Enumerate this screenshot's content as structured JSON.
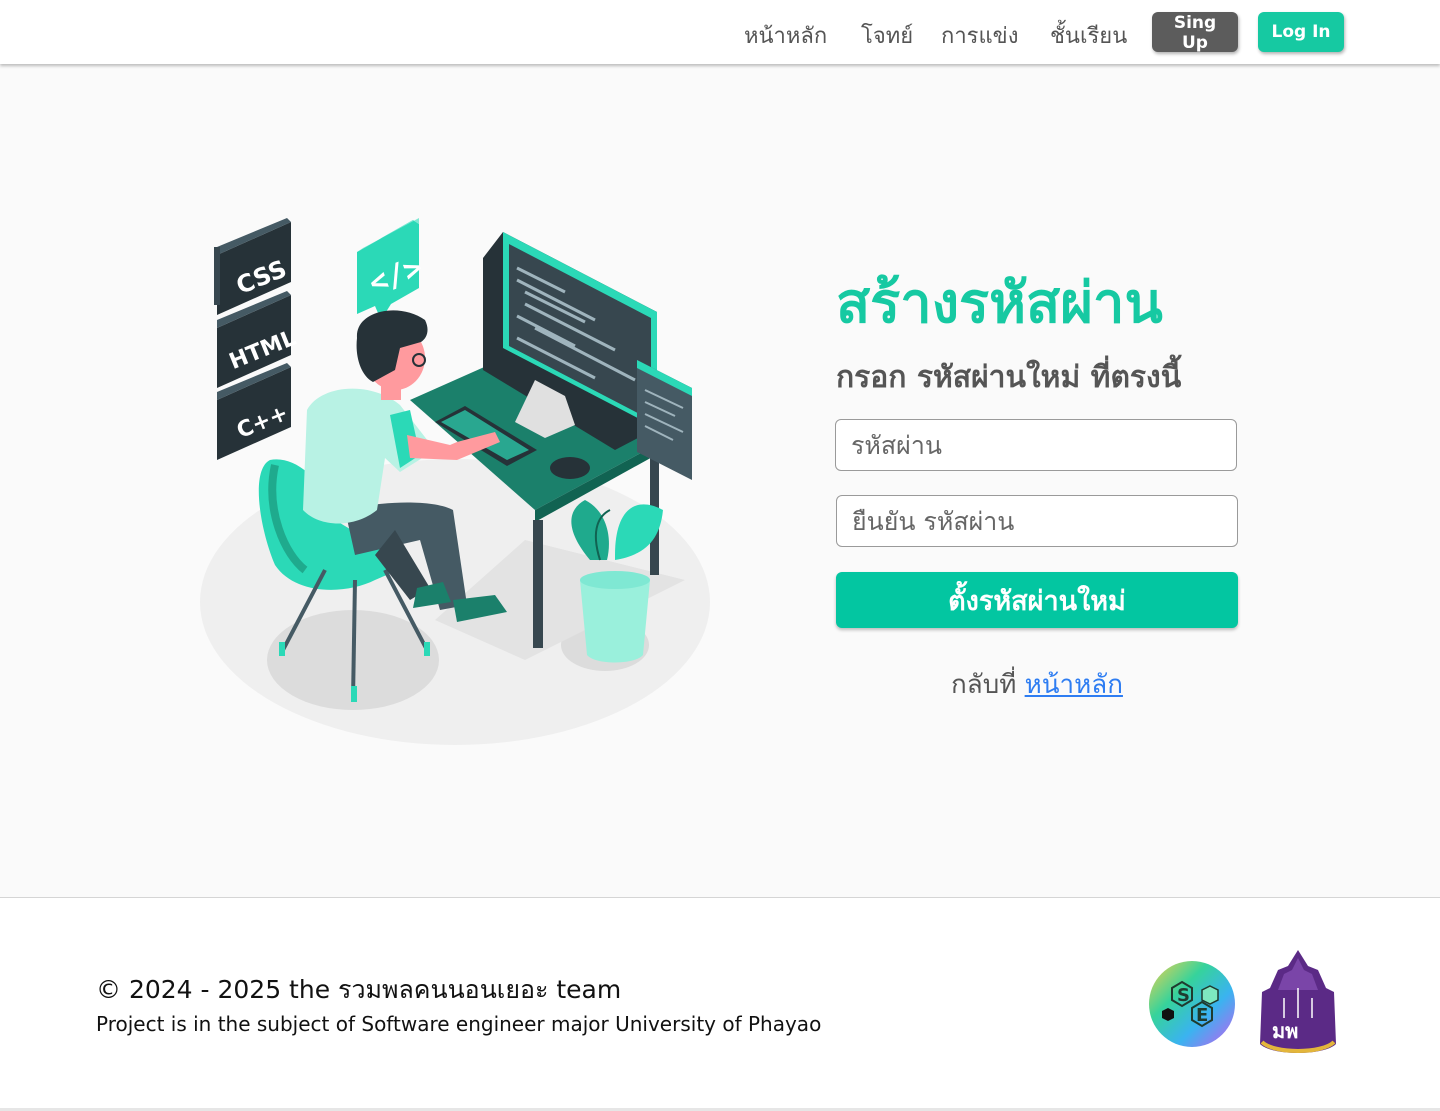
{
  "nav": {
    "links": [
      {
        "label": "หน้าหลัก"
      },
      {
        "label": "โจทย์"
      },
      {
        "label": "การแข่ง"
      },
      {
        "label": "ชั้นเรียน"
      }
    ],
    "signup_label": "Sing Up",
    "login_label": "Log In"
  },
  "illustration": {
    "badges": [
      "CSS",
      "HTML",
      "C++"
    ],
    "bubble_icon": "code-tag-icon",
    "colors": {
      "accent": "#2bd9b7",
      "dark": "#2e3e44",
      "desk": "#1b806b"
    }
  },
  "form": {
    "title": "สร้างรหัสผ่าน",
    "subtitle": "กรอก รหัสผ่านใหม่ ที่ตรงนี้",
    "password_placeholder": "รหัสผ่าน",
    "confirm_placeholder": "ยืนยัน รหัสผ่าน",
    "submit_label": "ตั้งรหัสผ่านใหม่",
    "back_prefix": "กลับที่",
    "back_link": "หน้าหลัก"
  },
  "footer": {
    "copyright": "© 2024 - 2025 the รวมพลคนนอนเยอะ team",
    "project": "Project is in the subject of Software engineer major University of Phayao",
    "logos": [
      "se-logo",
      "university-of-phayao-logo"
    ]
  },
  "colors": {
    "accent": "#16c9a2",
    "button_accent": "#03c6a1",
    "signup_bg": "#5c5c5c",
    "link": "#2e7df2"
  }
}
